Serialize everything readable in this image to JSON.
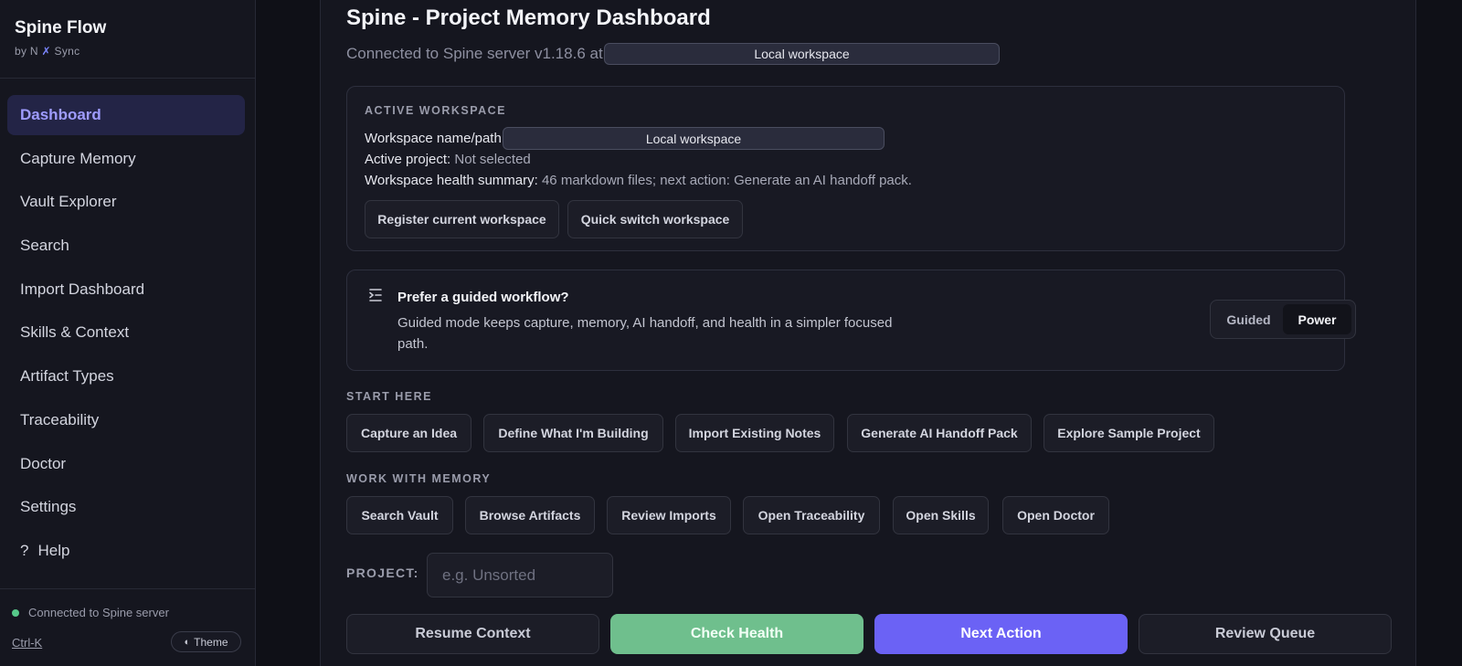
{
  "colors": {
    "accent": "#6b62f5",
    "success": "#6fbf8d",
    "status_dot": "#57c98a"
  },
  "sidebar": {
    "brand_title": "Spine Flow",
    "brand_sub_prefix": "by N",
    "brand_sub_x": "✗",
    "brand_sub_suffix": "Sync",
    "items": [
      {
        "label": "Dashboard",
        "active": true
      },
      {
        "label": "Capture Memory"
      },
      {
        "label": "Vault Explorer"
      },
      {
        "label": "Search"
      },
      {
        "label": "Import Dashboard"
      },
      {
        "label": "Skills & Context"
      },
      {
        "label": "Artifact Types"
      },
      {
        "label": "Traceability"
      },
      {
        "label": "Doctor"
      },
      {
        "label": "Settings"
      },
      {
        "label": "Help",
        "prefix": "?"
      }
    ],
    "status": "Connected to Spine server",
    "shortcut": "Ctrl-K",
    "theme_icon": "◐",
    "theme_label": "Theme"
  },
  "header": {
    "title": "Spine - Project Memory Dashboard",
    "connection_text": "Connected to Spine server v1.18.6 at (",
    "connection_redacted": "Local workspace"
  },
  "workspace": {
    "section_label": "ACTIVE WORKSPACE",
    "name_label": "Workspace name/path",
    "name_redacted": "Local workspace",
    "project_label": "Active project:",
    "project_value": "Not selected",
    "health_label": "Workspace health summary:",
    "health_value": "46 markdown files; next action: Generate an AI handoff pack.",
    "register_button": "Register current workspace",
    "switch_button": "Quick switch workspace"
  },
  "guided": {
    "icon": "indent-icon",
    "title": "Prefer a guided workflow?",
    "body_line1": "Guided mode keeps capture, memory, AI handoff, and health in a simpler focused",
    "body_line2": "path.",
    "toggle_guided": "Guided",
    "toggle_power": "Power",
    "selected": "Power"
  },
  "start_here": {
    "label": "START HERE",
    "buttons": [
      "Capture an Idea",
      "Define What I'm Building",
      "Import Existing Notes",
      "Generate AI Handoff Pack",
      "Explore Sample Project"
    ]
  },
  "work_memory": {
    "label": "WORK WITH MEMORY",
    "buttons": [
      "Search Vault",
      "Browse Artifacts",
      "Review Imports",
      "Open Traceability",
      "Open Skills",
      "Open Doctor"
    ]
  },
  "project": {
    "label": "PROJECT:",
    "placeholder": "e.g. Unsorted"
  },
  "actions": [
    "Resume Context",
    "Check Health",
    "Next Action",
    "Review Queue"
  ]
}
